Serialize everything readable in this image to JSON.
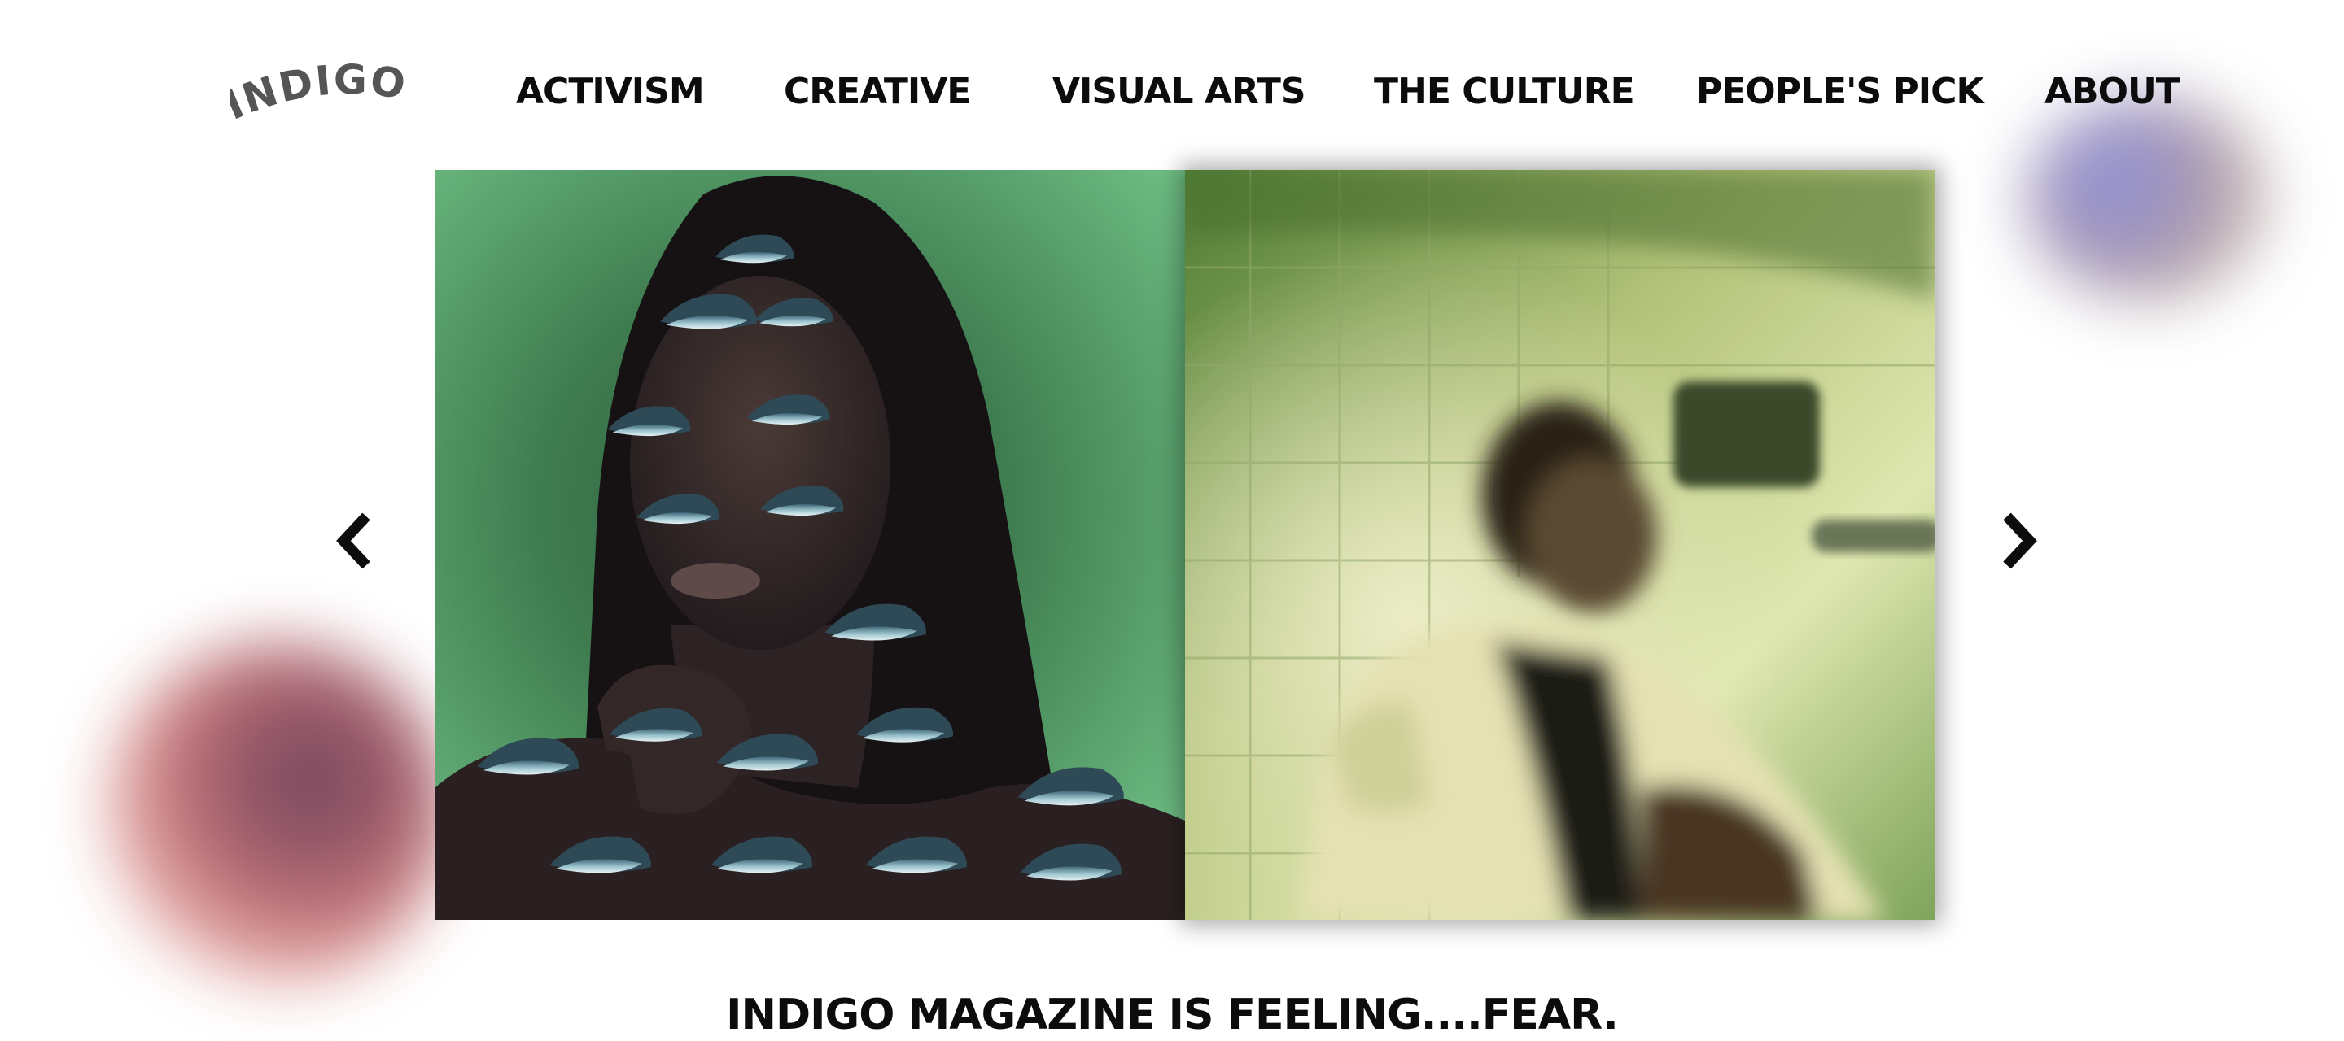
{
  "brand": {
    "logo_text": "INDIGO"
  },
  "nav": {
    "items": [
      {
        "label": "ACTIVISM"
      },
      {
        "label": "CREATIVE"
      },
      {
        "label": "VISUAL ARTS"
      },
      {
        "label": "THE CULTURE"
      },
      {
        "label": "PEOPLE'S PICK"
      },
      {
        "label": "ABOUT"
      }
    ]
  },
  "carousel": {
    "prev_icon": "chevron-left-icon",
    "next_icon": "chevron-right-icon",
    "slides": [
      {
        "image": "portrait-eyes-collage"
      },
      {
        "image": "blurred-figure-green-bathroom"
      }
    ]
  },
  "tagline": "INDIGO MAGAZINE IS FEELING....FEAR.",
  "colors": {
    "text": "#0c0c0c",
    "background": "#ffffff",
    "slide_green": "#4f9b62",
    "slide_lime": "#b9c77a",
    "blob_indigo": "#7f86d6",
    "blob_rose": "#a45a66"
  }
}
